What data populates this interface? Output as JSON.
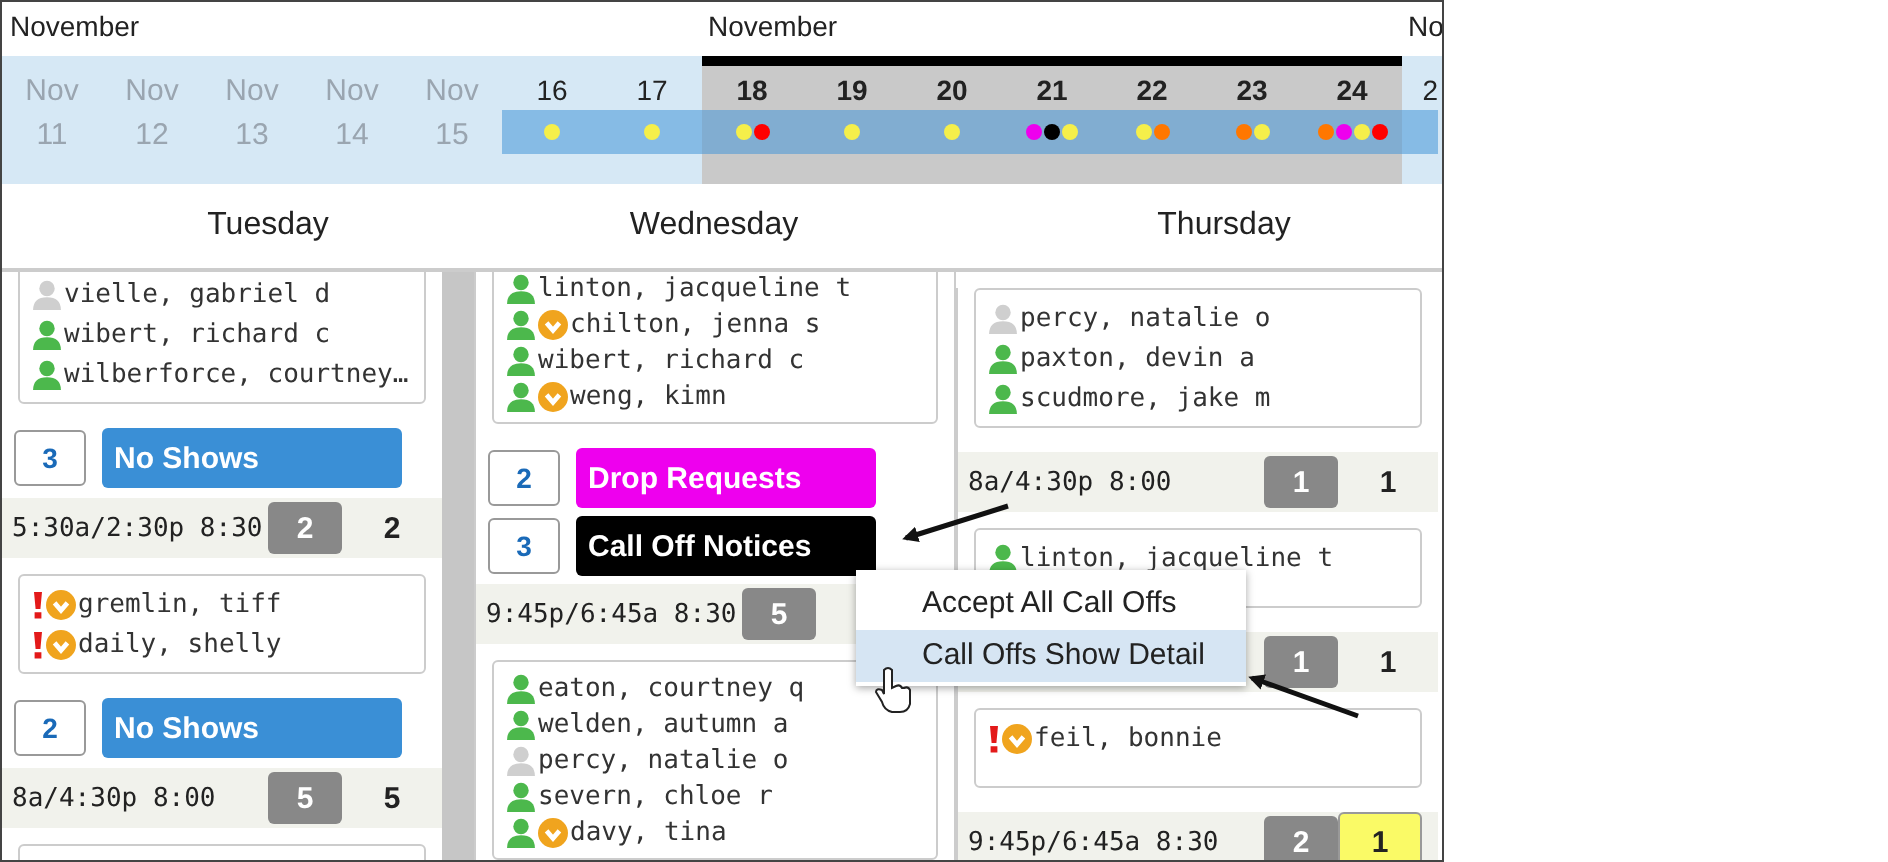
{
  "calendar": {
    "months": [
      {
        "label": "November",
        "days": [
          {
            "month": "Nov",
            "day": "11",
            "past": true,
            "selected": false
          },
          {
            "month": "Nov",
            "day": "12",
            "past": true,
            "selected": false
          },
          {
            "month": "Nov",
            "day": "13",
            "past": true,
            "selected": false
          },
          {
            "month": "Nov",
            "day": "14",
            "past": true,
            "selected": false
          },
          {
            "month": "Nov",
            "day": "15",
            "past": true,
            "selected": false
          },
          {
            "day": "16",
            "past": false,
            "selected": false,
            "dots": [
              {
                "color": "#f5ef4a"
              }
            ]
          },
          {
            "day": "17",
            "past": false,
            "selected": false,
            "dots": [
              {
                "color": "#f5ef4a"
              }
            ]
          }
        ]
      },
      {
        "label": "November",
        "days": [
          {
            "day": "18",
            "past": false,
            "selected": true,
            "dots": [
              {
                "color": "#f5ef4a"
              },
              {
                "color": "#ff0000"
              }
            ]
          },
          {
            "day": "19",
            "past": false,
            "selected": true,
            "dots": [
              {
                "color": "#f5ef4a"
              }
            ]
          },
          {
            "day": "20",
            "past": false,
            "selected": true,
            "dots": [
              {
                "color": "#f5ef4a"
              }
            ]
          },
          {
            "day": "21",
            "past": false,
            "selected": true,
            "dots": [
              {
                "color": "#ee00ee"
              },
              {
                "color": "#000000"
              },
              {
                "color": "#f5ef4a"
              }
            ]
          },
          {
            "day": "22",
            "past": false,
            "selected": true,
            "dots": [
              {
                "color": "#f5ef4a"
              },
              {
                "color": "#ff7700"
              }
            ]
          },
          {
            "day": "23",
            "past": false,
            "selected": true,
            "dots": [
              {
                "color": "#ff7700"
              },
              {
                "color": "#f5ef4a"
              }
            ]
          },
          {
            "day": "24",
            "past": false,
            "selected": true,
            "dots": [
              {
                "color": "#ff7700"
              },
              {
                "color": "#ee00ee"
              },
              {
                "color": "#f5ef4a"
              },
              {
                "color": "#ff0000"
              }
            ]
          }
        ]
      },
      {
        "label": "No",
        "days": [
          {
            "day": "2",
            "past": false,
            "selected": false
          }
        ]
      }
    ]
  },
  "columns": [
    {
      "day_name": "Tuesday",
      "blocks": [
        {
          "kind": "card",
          "people": [
            {
              "name": "vielle, gabriel d",
              "icons": [
                {
                  "kind": "person",
                  "active": false
                }
              ]
            },
            {
              "name": "wibert, richard c",
              "icons": [
                {
                  "kind": "person",
                  "active": true
                }
              ]
            },
            {
              "name": "wilberforce, courtney…",
              "icons": [
                {
                  "kind": "person",
                  "active": true
                }
              ]
            }
          ]
        },
        {
          "kind": "action",
          "count": "3",
          "label": "No Shows",
          "color": "#3a8fd6"
        },
        {
          "kind": "shift",
          "time": "5:30a/2:30p 8:30",
          "badge": "2",
          "total": "2",
          "highlighted": false
        },
        {
          "kind": "card",
          "people": [
            {
              "name": "gremlin, tiff",
              "icons": [
                {
                  "kind": "alert"
                },
                {
                  "kind": "down"
                }
              ]
            },
            {
              "name": "daily, shelly",
              "icons": [
                {
                  "kind": "alert"
                },
                {
                  "kind": "down"
                }
              ]
            }
          ]
        },
        {
          "kind": "action",
          "count": "2",
          "label": "No Shows",
          "color": "#3a8fd6"
        },
        {
          "kind": "shift",
          "time": "8a/4:30p 8:00",
          "badge": "5",
          "total": "5",
          "highlighted": false
        },
        {
          "kind": "card"
        }
      ]
    },
    {
      "day_name": "Wednesday",
      "blocks": [
        {
          "kind": "card",
          "people": [
            {
              "name": "linton, jacqueline t",
              "icons": [
                {
                  "kind": "person",
                  "active": true
                }
              ]
            },
            {
              "name": "chilton, jenna s",
              "icons": [
                {
                  "kind": "person",
                  "active": true
                },
                {
                  "kind": "down"
                }
              ]
            },
            {
              "name": "wibert, richard c",
              "icons": [
                {
                  "kind": "person",
                  "active": true
                }
              ]
            },
            {
              "name": "weng, kimn",
              "icons": [
                {
                  "kind": "person",
                  "active": true
                },
                {
                  "kind": "down"
                }
              ]
            }
          ]
        },
        {
          "kind": "action",
          "count": "2",
          "label": "Drop Requests",
          "color": "#ee00ee"
        },
        {
          "kind": "action",
          "count": "3",
          "label": "Call Off Notices",
          "color": "#000000"
        },
        {
          "kind": "shift",
          "time": "9:45p/6:45a 8:30",
          "badge": "5"
        },
        {
          "kind": "card",
          "people": [
            {
              "name": "eaton, courtney q",
              "icons": [
                {
                  "kind": "person",
                  "active": true
                }
              ]
            },
            {
              "name": "welden, autumn a",
              "icons": [
                {
                  "kind": "person",
                  "active": true
                }
              ]
            },
            {
              "name": "percy, natalie o",
              "icons": [
                {
                  "kind": "person",
                  "active": false
                }
              ]
            },
            {
              "name": "severn, chloe r",
              "icons": [
                {
                  "kind": "person",
                  "active": true
                }
              ]
            },
            {
              "name": "davy, tina",
              "icons": [
                {
                  "kind": "person",
                  "active": true
                },
                {
                  "kind": "down"
                }
              ]
            }
          ]
        }
      ]
    },
    {
      "day_name": "Thursday",
      "blocks": [
        {
          "kind": "card",
          "people": [
            {
              "name": "percy, natalie o",
              "icons": [
                {
                  "kind": "person",
                  "active": false
                }
              ]
            },
            {
              "name": "paxton, devin a",
              "icons": [
                {
                  "kind": "person",
                  "active": true
                }
              ]
            },
            {
              "name": "scudmore, jake m",
              "icons": [
                {
                  "kind": "person",
                  "active": true
                }
              ]
            }
          ]
        },
        {
          "kind": "shift",
          "time": "8a/4:30p 8:00",
          "badge": "1",
          "total": "1",
          "highlighted": false
        },
        {
          "kind": "card",
          "people": [
            {
              "name": "linton, jacqueline t",
              "icons": [
                {
                  "kind": "person",
                  "active": true
                }
              ]
            }
          ]
        },
        {
          "kind": "shift",
          "badge": "1",
          "total": "1",
          "highlighted": false
        },
        {
          "kind": "card",
          "people": [
            {
              "name": "feil, bonnie",
              "icons": [
                {
                  "kind": "alert"
                },
                {
                  "kind": "down"
                }
              ]
            }
          ]
        },
        {
          "kind": "shift",
          "time": "9:45p/6:45a 8:30",
          "badge": "2",
          "total": "1",
          "highlighted": true
        }
      ]
    }
  ],
  "context_menu": {
    "items": [
      {
        "label": "Accept All Call Offs",
        "selected": false
      },
      {
        "label": "Call Offs Show Detail",
        "selected": true
      }
    ]
  }
}
